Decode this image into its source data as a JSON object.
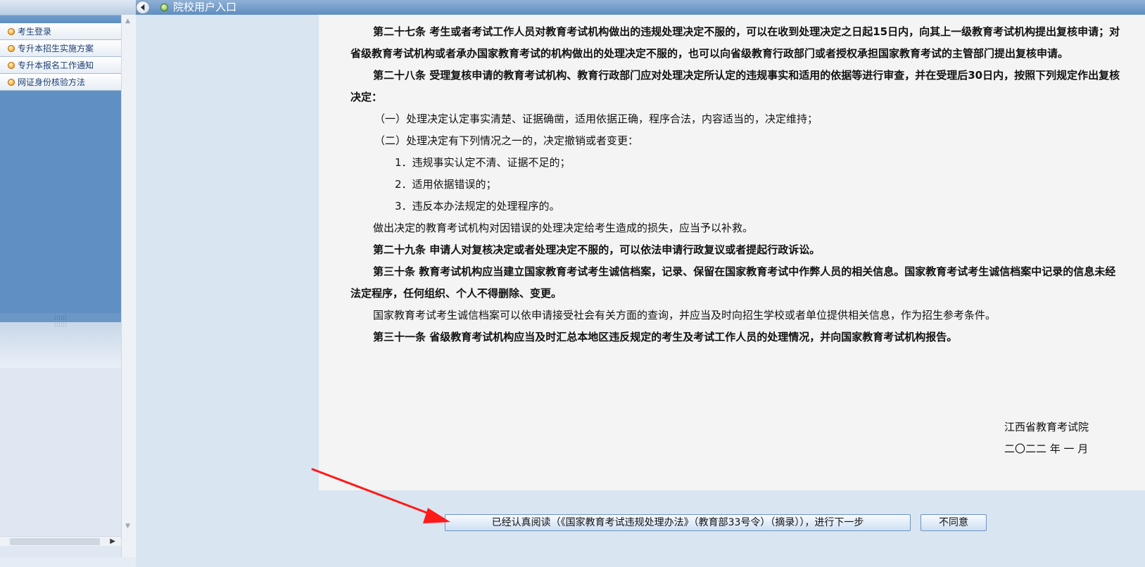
{
  "header": {
    "portal_title": "院校用户入口"
  },
  "sidebar": {
    "items": [
      {
        "label": "考生登录"
      },
      {
        "label": "专升本招生实施方案"
      },
      {
        "label": "专升本报名工作通知"
      },
      {
        "label": "网证身份核验方法"
      }
    ]
  },
  "document": {
    "paragraphs": [
      {
        "type": "art",
        "text": "第二十七条 考生或者考试工作人员对教育考试机构做出的违规处理决定不服的，可以在收到处理决定之日起15日内，向其上一级教育考试机构提出复核申请；对省级教育考试机构或者承办国家教育考试的机构做出的处理决定不服的，也可以向省级教育行政部门或者授权承担国家教育考试的主管部门提出复核申请。"
      },
      {
        "type": "art",
        "text": "第二十八条 受理复核申请的教育考试机构、教育行政部门应对处理决定所认定的违规事实和适用的依据等进行审查，并在受理后30日内，按照下列规定作出复核决定："
      },
      {
        "type": "item1",
        "text": "（一）处理决定认定事实清楚、证据确凿，适用依据正确，程序合法，内容适当的，决定维持；"
      },
      {
        "type": "item1",
        "text": "（二）处理决定有下列情况之一的，决定撤销或者变更："
      },
      {
        "type": "item2",
        "text": "1．违规事实认定不清、证据不足的；"
      },
      {
        "type": "item2",
        "text": "2．适用依据错误的；"
      },
      {
        "type": "item2",
        "text": "3．违反本办法规定的处理程序的。"
      },
      {
        "type": "plain",
        "text": "做出决定的教育考试机构对因错误的处理决定给考生造成的损失，应当予以补救。"
      },
      {
        "type": "art",
        "text": "第二十九条 申请人对复核决定或者处理决定不服的，可以依法申请行政复议或者提起行政诉讼。"
      },
      {
        "type": "art",
        "text": "第三十条 教育考试机构应当建立国家教育考试考生诚信档案，记录、保留在国家教育考试中作弊人员的相关信息。国家教育考试考生诚信档案中记录的信息未经法定程序，任何组织、个人不得删除、变更。"
      },
      {
        "type": "plain",
        "text": "国家教育考试考生诚信档案可以依申请接受社会有关方面的查询，并应当及时向招生学校或者单位提供相关信息，作为招生参考条件。"
      },
      {
        "type": "art",
        "text": "第三十一条 省级教育考试机构应当及时汇总本地区违反规定的考生及考试工作人员的处理情况，并向国家教育考试机构报告。"
      }
    ],
    "signature_org": "江西省教育考试院",
    "signature_date": "二〇二二 年 一 月"
  },
  "actions": {
    "agree_label": "已经认真阅读（《国家教育考试违规处理办法》（教育部33号令）（摘录）），进行下一步",
    "disagree_label": "不同意"
  },
  "colors": {
    "sidebar_bg": "#5f8fc3",
    "page_bg": "#d9e5f0",
    "doc_bg": "#f4f4f4",
    "annotation_arrow": "#ff1a1a"
  }
}
